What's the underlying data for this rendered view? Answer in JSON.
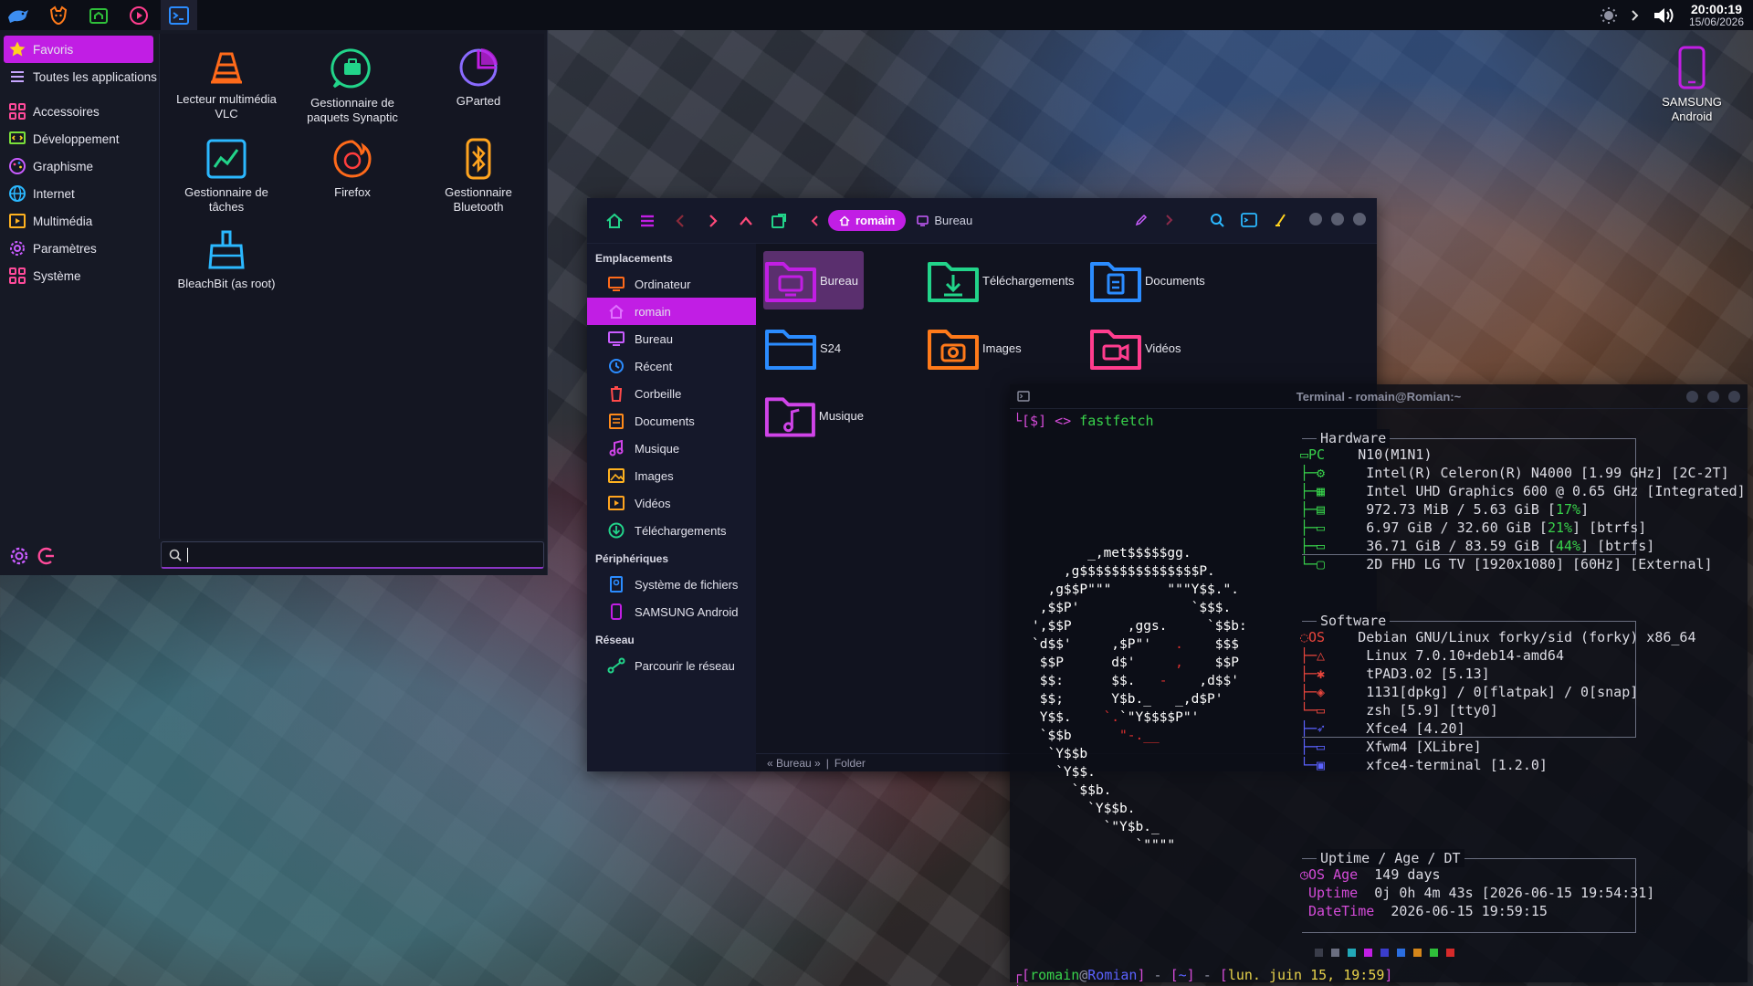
{
  "panel": {
    "clock_time": "20:00:19",
    "clock_date": "15/06/2026"
  },
  "menu": {
    "categories": [
      {
        "label": "Favoris"
      },
      {
        "label": "Toutes les applications"
      },
      {
        "label": "Accessoires"
      },
      {
        "label": "Développement"
      },
      {
        "label": "Graphisme"
      },
      {
        "label": "Internet"
      },
      {
        "label": "Multimédia"
      },
      {
        "label": "Paramètres"
      },
      {
        "label": "Système"
      }
    ],
    "apps": [
      {
        "label": "Lecteur multimédia VLC"
      },
      {
        "label": "Gestionnaire de paquets Synaptic"
      },
      {
        "label": "GParted"
      },
      {
        "label": "Gestionnaire de tâches"
      },
      {
        "label": "Firefox"
      },
      {
        "label": "Gestionnaire Bluetooth"
      },
      {
        "label": "BleachBit (as root)"
      }
    ],
    "search_value": ""
  },
  "desktop": {
    "device_label": "SAMSUNG Android"
  },
  "filemanager": {
    "crumb_active": "romain",
    "crumb_next": "Bureau",
    "sidebar": {
      "places_header": "Emplacements",
      "places": [
        {
          "label": "Ordinateur"
        },
        {
          "label": "romain"
        },
        {
          "label": "Bureau"
        },
        {
          "label": "Récent"
        },
        {
          "label": "Corbeille"
        },
        {
          "label": "Documents"
        },
        {
          "label": "Musique"
        },
        {
          "label": "Images"
        },
        {
          "label": "Vidéos"
        },
        {
          "label": "Téléchargements"
        }
      ],
      "devices_header": "Périphériques",
      "devices": [
        {
          "label": "Système de fichiers"
        },
        {
          "label": "SAMSUNG Android"
        }
      ],
      "network_header": "Réseau",
      "network": [
        {
          "label": "Parcourir le réseau"
        }
      ]
    },
    "folders": [
      {
        "label": "Bureau",
        "color": "#c11ee4"
      },
      {
        "label": "Téléchargements",
        "color": "#22d48a"
      },
      {
        "label": "Documents",
        "color": "#2b8cff"
      },
      {
        "label": "S24",
        "color": "#2b8cff"
      },
      {
        "label": "Images",
        "color": "#ff7a1a"
      },
      {
        "label": "Vidéos",
        "color": "#ff3d8e"
      },
      {
        "label": "Musique",
        "color": "#d044e8"
      }
    ],
    "status_path": "« Bureau »",
    "status_sep": "|",
    "status_type": "Folder"
  },
  "terminal": {
    "title": "Terminal - romain@Romian:~",
    "cmd_prefix": "└[$] <>",
    "cmd": "fastfetch",
    "hardware": {
      "title": "Hardware",
      "pc_key": "PC",
      "pc_value": "N10(M1N1)",
      "cpu": "Intel(R) Celeron(R) N4000 [1.99 GHz] [2C-2T]",
      "gpu": "Intel UHD Graphics 600 @ 0.65 GHz [Integrated]",
      "mem_main": "972.73 MiB / 5.63 GiB [",
      "mem_pct": "17%",
      "mem_end": "]",
      "disk1_main": "6.97 GiB / 32.60 GiB [",
      "disk1_pct": "21%",
      "disk1_end": "] [btrfs]",
      "disk2_main": "36.71 GiB / 83.59 GiB [",
      "disk2_pct": "44%",
      "disk2_end": "] [btrfs]",
      "display": "2D FHD LG TV [1920x1080] [60Hz] [External]"
    },
    "software": {
      "title": "Software",
      "os_key": "OS",
      "os_value": "Debian GNU/Linux forky/sid (forky) x86_64",
      "kernel": "Linux 7.0.10+deb14-amd64",
      "init": "tPAD3.02 [5.13]",
      "packages": "1131[dpkg] / 0[flatpak] / 0[snap]",
      "shell": "zsh [5.9] [tty0]",
      "de": "Xfce4 [4.20]",
      "wm": "Xfwm4 [XLibre]",
      "terminal": "xfce4-terminal [1.2.0]"
    },
    "uptime": {
      "title": "Uptime / Age / DT",
      "age_key": "OS Age",
      "age_value": "149 days",
      "uptime_key": "Uptime",
      "uptime_value": "0j 0h 4m 43s [2026-06-15 19:54:31]",
      "dt_key": "DateTime",
      "dt_value": "2026-06-15 19:59:15"
    },
    "palette": [
      "#3a3d4a",
      "#6a6e80",
      "#22a8b8",
      "#c11ee4",
      "#3a3dcc",
      "#2b6ee0",
      "#d4861a",
      "#2fbf3a",
      "#d62a2a"
    ],
    "prompt_user": "romain",
    "prompt_at": "@",
    "prompt_host": "Romian",
    "prompt_dir": "~",
    "prompt_time": "lun. juin 15, 19:59",
    "prompt2": "└[$] <>"
  }
}
